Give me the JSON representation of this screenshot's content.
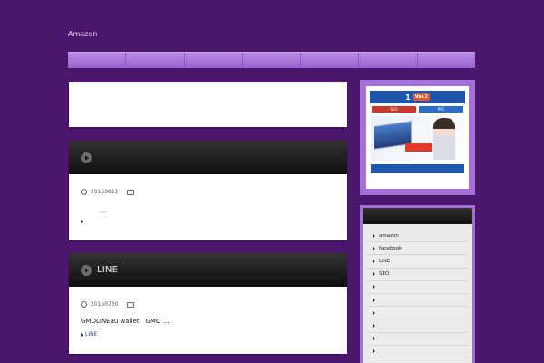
{
  "site": {
    "title": "Amazon"
  },
  "nav": {
    "item_count": 7
  },
  "posts": [
    {
      "title": "",
      "date": "20160811",
      "excerpt": "....",
      "tags": []
    },
    {
      "title": "LINE",
      "date": "20160730",
      "excerpt": "GMOLINEau wallet　GMO ....",
      "tags": [
        "LINE"
      ]
    }
  ],
  "sidebar": {
    "banner": {
      "line1": "",
      "brand": "1",
      "version": "Ver.2",
      "tag1": "SEO",
      "tag2": "PPC",
      "stamp": "",
      "footer": ""
    },
    "categories": [
      "amazon",
      "facebook",
      "LINE",
      "SEO",
      "",
      "",
      "",
      "",
      "",
      ""
    ]
  },
  "colors": {
    "background": "#4d166e",
    "nav": "#a56fd8",
    "header": "#111111"
  }
}
